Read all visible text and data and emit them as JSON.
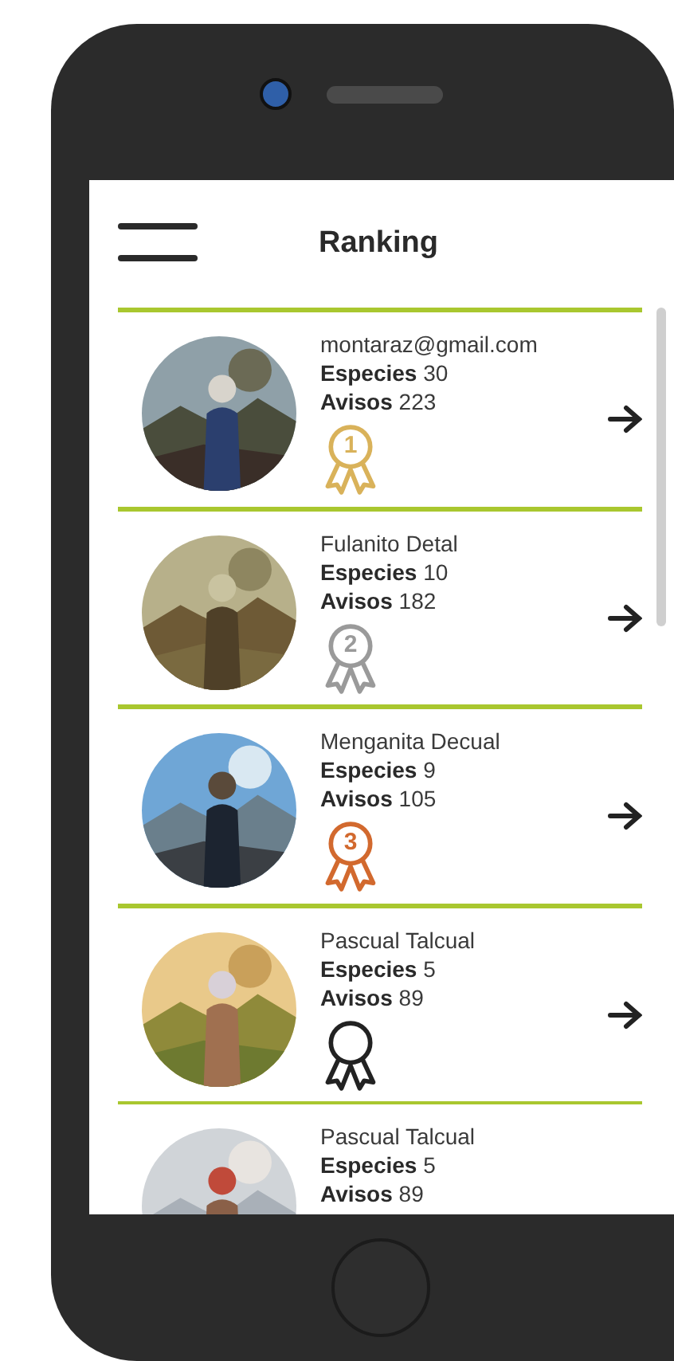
{
  "header": {
    "title": "Ranking"
  },
  "rows": [
    {
      "name": "montaraz@gmail.com",
      "species_label": "Especies",
      "species": "30",
      "reports_label": "Avisos",
      "reports": "223",
      "medal": {
        "label": "1",
        "color": "#d9b25a"
      },
      "arrow": true
    },
    {
      "name": "Fulanito Detal",
      "species_label": "Especies",
      "species": "10",
      "reports_label": "Avisos",
      "reports": "182",
      "medal": {
        "label": "2",
        "color": "#9a9a9a"
      },
      "arrow": true
    },
    {
      "name": "Menganita Decual",
      "species_label": "Especies",
      "species": "9",
      "reports_label": "Avisos",
      "reports": "105",
      "medal": {
        "label": "3",
        "color": "#d2692e"
      },
      "arrow": true
    },
    {
      "name": "Pascual Talcual",
      "species_label": "Especies",
      "species": "5",
      "reports_label": "Avisos",
      "reports": "89",
      "medal": {
        "color": "#222222"
      },
      "arrow": true
    },
    {
      "name": "Pascual Talcual",
      "species_label": "Especies",
      "species": "5",
      "reports_label": "Avisos",
      "reports": "89",
      "arrow": false
    }
  ]
}
